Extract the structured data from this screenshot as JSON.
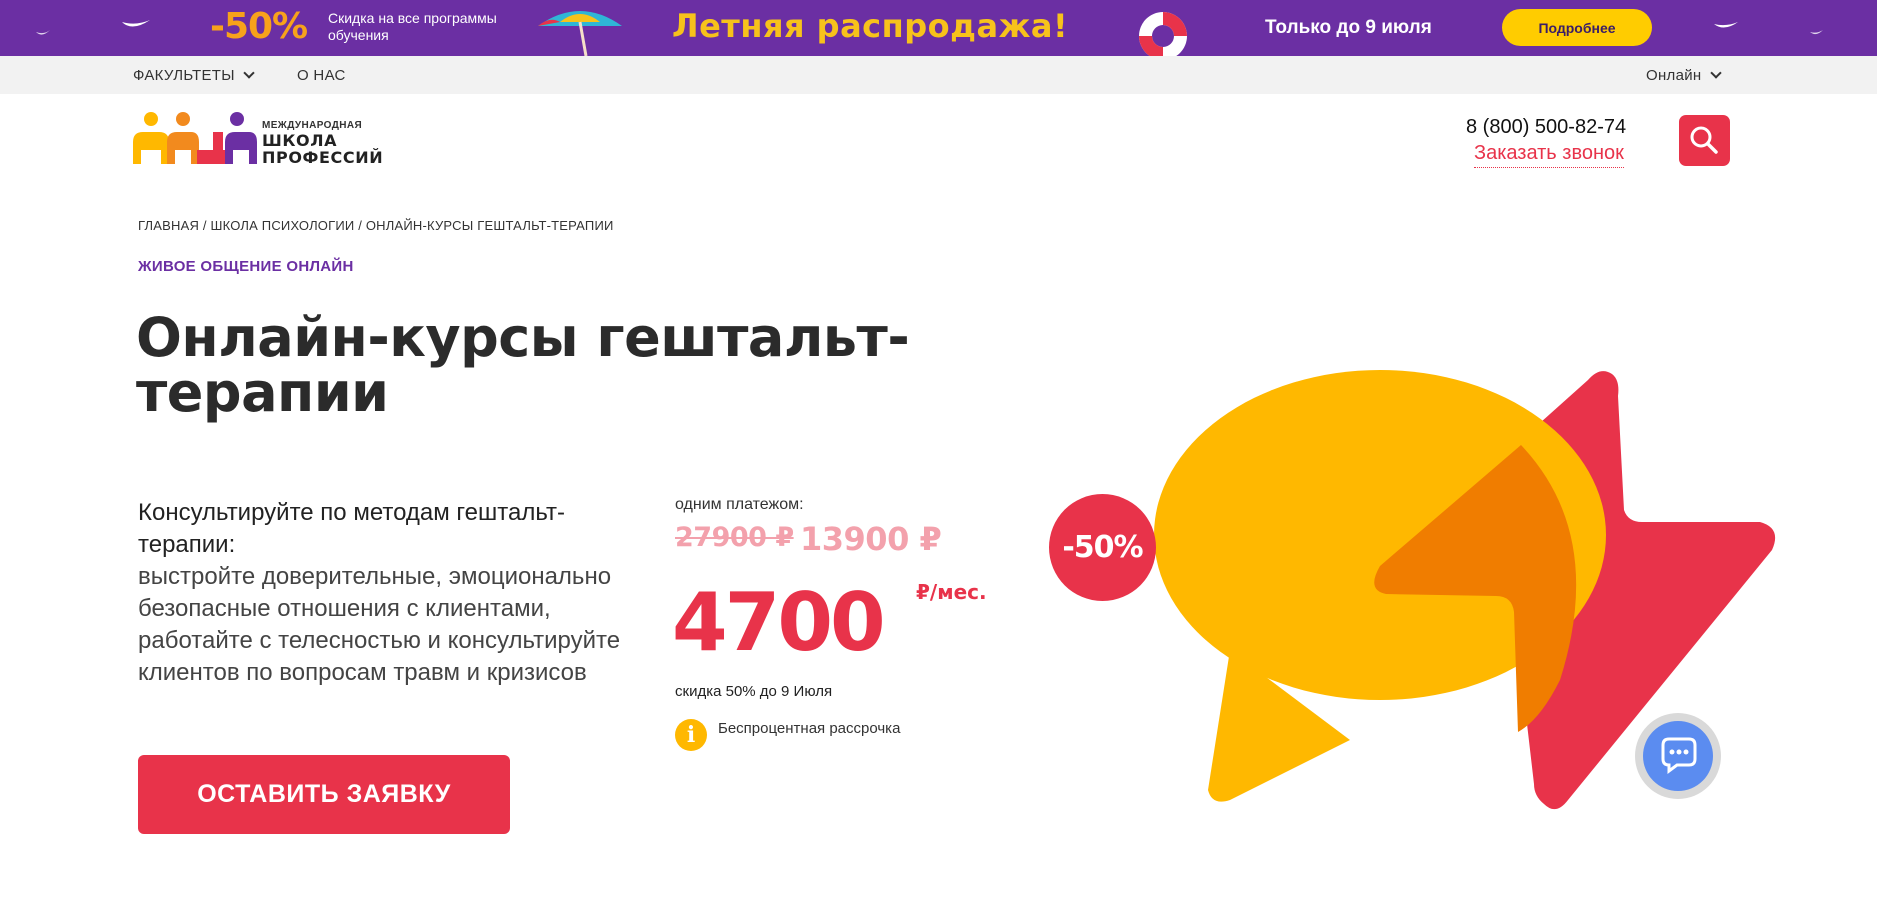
{
  "promo": {
    "discount": "-50%",
    "subtitle": "Скидка на все программы обучения",
    "headline": "Летняя распродажа!",
    "until": "Только до 9 июля",
    "more_label": "Подробнее",
    "colors": {
      "background": "#6b2fa3",
      "accent": "#f7c21b",
      "button": "#ffcc00"
    }
  },
  "topnav": {
    "faculties": "ФАКУЛЬТЕТЫ",
    "about": "О НАС",
    "mode": "Онлайн"
  },
  "header": {
    "logo_small": "МЕЖДУНАРОДНАЯ",
    "logo_line1": "ШКОЛА",
    "logo_line2": "ПРОФЕССИЙ",
    "phone": "8 (800) 500-82-74",
    "callback": "Заказать звонок",
    "search_icon": "search-icon"
  },
  "breadcrumbs": "ГЛАВНАЯ / ШКОЛА ПСИХОЛОГИИ / ОНЛАЙН-КУРСЫ ГЕШТАЛЬТ-ТЕРАПИИ",
  "tagline": "ЖИВОЕ ОБЩЕНИЕ ОНЛАЙН",
  "title": "Онлайн-курсы гештальт-терапии",
  "description": {
    "heading": "Консультируйте по методам гештальт-терапии:",
    "body": "выстройте доверительные, эмоционально безопасные отношения с клиентами, работайте с телесностью и консультируйте клиентов по вопросам травм и кризисов"
  },
  "cta_label": "ОСТАВИТЬ ЗАЯВКУ",
  "pricing": {
    "once_label": "одним платежом:",
    "old_price": "27900 ₽",
    "new_price": "13900 ₽",
    "monthly": "4700",
    "per": "₽/мес.",
    "discount_note": "скидка 50% до 9 Июля",
    "installment": "Беспроцентная рассрочка",
    "info_icon": "info-icon"
  },
  "badge": "-50%",
  "colors": {
    "brand_red": "#e8334a",
    "brand_purple": "#6b2fa3",
    "yellow": "#ffb800"
  }
}
